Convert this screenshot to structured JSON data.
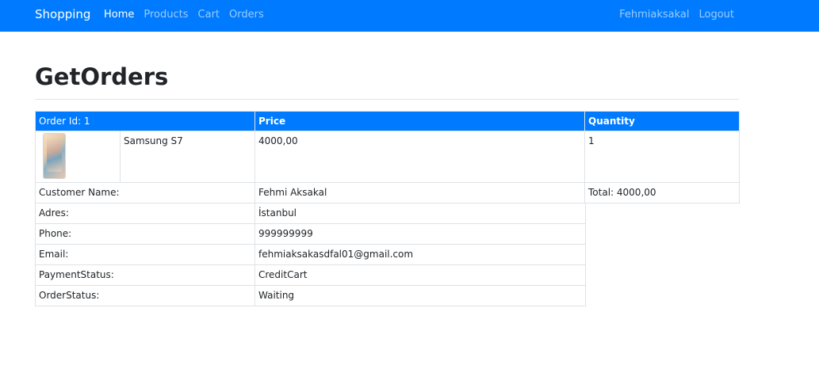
{
  "nav": {
    "brand": "Shopping",
    "links": [
      "Home",
      "Products",
      "Cart",
      "Orders"
    ],
    "user": "Fehmiaksakal",
    "logout": "Logout"
  },
  "page": {
    "title": "GetOrders"
  },
  "order": {
    "header": {
      "order_id": "Order Id: 1",
      "price": "Price",
      "quantity": "Quantity"
    },
    "item": {
      "name": "Samsung S7",
      "price": "4000,00",
      "quantity": "1",
      "image_icon": "phone-image"
    },
    "summary": {
      "customer_label": "Customer Name:",
      "customer_value": "Fehmi Aksakal",
      "total": "Total: 4000,00"
    }
  },
  "customer": {
    "rows": [
      {
        "label": "Adres:",
        "value": "İstanbul"
      },
      {
        "label": "Phone:",
        "value": "999999999"
      },
      {
        "label": "Email:",
        "value": "fehmiaksakasdfal01@gmail.com"
      },
      {
        "label": "PaymentStatus:",
        "value": "CreditCart"
      },
      {
        "label": "OrderStatus:",
        "value": "Waiting"
      }
    ]
  }
}
